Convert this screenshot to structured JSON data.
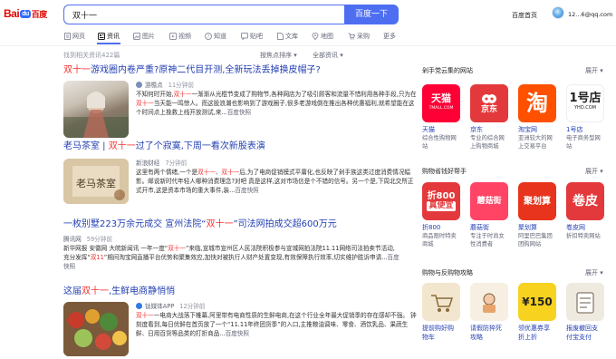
{
  "logo": {
    "part1": "Bai",
    "paw": "du",
    "part2": "百度"
  },
  "search": {
    "query": "双十一",
    "button": "百度一下"
  },
  "header": {
    "home": "百度首页",
    "user": "12...6@qq.com"
  },
  "tabs": [
    {
      "label": "网页",
      "icon": "page-icon"
    },
    {
      "label": "资讯",
      "icon": "news-icon"
    },
    {
      "label": "图片",
      "icon": "image-icon"
    },
    {
      "label": "视频",
      "icon": "video-icon"
    },
    {
      "label": "知道",
      "icon": "question-icon"
    },
    {
      "label": "贴吧",
      "icon": "forum-icon"
    },
    {
      "label": "文库",
      "icon": "doc-icon"
    },
    {
      "label": "地图",
      "icon": "map-icon"
    },
    {
      "label": "采购",
      "icon": "cart-icon"
    },
    {
      "label": "更多",
      "icon": ""
    }
  ],
  "filters": {
    "count": "找到相关资讯422篇",
    "time": "按焦点排序",
    "scope": "全部资讯"
  },
  "results": [
    {
      "title_pre": "双十一",
      "title_rest": "游戏圈内卷严重?原神二代目开测,全新玩法丢掉换皮帽子?",
      "source": "游檐点",
      "time": "11分钟前",
      "snippet_a": "不知何时开始,",
      "snippet_em": "双十一",
      "snippet_b": "一渐渐从光棍节变成了购物节,各种网店为了吸引顾客和流量不惜利用各种手段,只为在",
      "snippet_em2": "双十一",
      "snippet_c": "当天能一鸣惊人。而这股浪潮也影响到了游戏圈子,很多老游戏倒在推出各种优惠福利,就希望能在这个时间点上挽救上线开放测试,来...",
      "more": "百度快照"
    },
    {
      "title_pre": "老马茶室 | ",
      "title_em": "双十一",
      "title_rest": "过了个寂寞,下周一看次新股表演",
      "source": "新浪财经",
      "time": "7分钟前",
      "snippet_a": "这里有两个情绪,一个是",
      "snippet_em": "双十一",
      "snippet_b": "、",
      "snippet_em2": "双十一",
      "snippet_c": "后,为了电商促销模式平庸化,也反映了剁手族这类过度消费情况幅影。邮说新时代年轻人哪种消费理念?对吧 真是这样,这对市场信是个不错的信号。另一个是,下周北交所正式开市,这是资本市场的重大事件,装...",
      "more": "百度快照"
    },
    {
      "title_a": "一枚别墅223万余元成交 宣州法院“",
      "title_em": "双十一",
      "title_rest": "”司法网拍成交超600万元",
      "source": "腾讯网",
      "time": "59分钟前",
      "snippet_a": "新华网报 安徽网 大皖新闻讯 一年一度“",
      "snippet_em": "双十一",
      "snippet_b": "”来临,宣城市宣州区人民法院积极参与宣城网拍法院11.11网络司法拍卖节活动,充分发挥“",
      "snippet_em2": "双11",
      "snippet_c": "”期间淘宝网直播平台优势和聚集效应,加快对被执行人财产处置变现,有效保障执行效率,切实维护胜诉申请...",
      "more": "百度快照"
    },
    {
      "title_pre": "这届",
      "title_em": "双十一",
      "title_rest": ",生鲜电商静悄悄",
      "source": "钛媒体APP",
      "time": "12分钟前",
      "snippet_em": "双十一",
      "snippet_a": "",
      "snippet_b": "一电商大战落下帷幕,阿里带有电商性质的生鲜电商,在这个行业全年最大促销季的存在感却不强。 钟刻度看到,每日优鲜在首页放了一个“11.11年终团货季”的入口,主推粮油调味、零食、酒饮乳品、果蔬生鲜、日用百货等品类的打折商品...",
      "snippet_em2": "",
      "snippet_c": "",
      "more": "百度快照"
    }
  ],
  "sidebar": {
    "sections": [
      {
        "title": "剁手党云集的网站",
        "expand": "展开",
        "apps": [
          {
            "name": "天猫",
            "desc1": "综合性购物网",
            "desc2": "站",
            "icon_text": "天猫\nTMALL.COM",
            "color": "#ff0036",
            "icon": "tmall-icon"
          },
          {
            "name": "京东",
            "desc1": "专业的综合网",
            "desc2": "上购物商城",
            "icon_text": "京东",
            "color": "#e4393c",
            "icon": "jd-icon"
          },
          {
            "name": "淘宝网",
            "desc1": "亚洲较大的网",
            "desc2": "上交易平台",
            "icon_text": "淘",
            "color": "#ff5000",
            "icon": "taobao-icon"
          },
          {
            "name": "1号店",
            "desc1": "电子商务型网",
            "desc2": "站",
            "icon_text": "1号店\nYHD.COM",
            "color": "#ffffff",
            "icon": "yhd-icon"
          }
        ]
      },
      {
        "title": "购物省钱好帮手",
        "expand": "展开",
        "apps": [
          {
            "name": "折800",
            "desc1": "商品限时特卖",
            "desc2": "商城",
            "icon_text": "折800\n真便宜",
            "color": "#e4393c",
            "icon": "zhe800-icon"
          },
          {
            "name": "蘑菇街",
            "desc1": "专注于时尚女",
            "desc2": "性消费者",
            "icon_text": "蘑菇街",
            "color": "#ff4466",
            "icon": "mogu-icon"
          },
          {
            "name": "聚划算",
            "desc1": "阿里巴巴集团",
            "desc2": "团购网站",
            "icon_text": "聚划算",
            "color": "#e8341c",
            "icon": "juhuasuan-icon"
          },
          {
            "name": "卷皮网",
            "desc1": "折扣特卖网站",
            "desc2": "",
            "icon_text": "卷皮",
            "color": "#e4393c",
            "icon": "juanpi-icon"
          }
        ]
      },
      {
        "title": "购物与反购物攻略",
        "expand": "展开",
        "apps": [
          {
            "name": "提前购好购",
            "desc1": "物车",
            "desc2": "",
            "icon_text": "",
            "color": "#f2e6cf",
            "icon": "cart-plan-icon"
          },
          {
            "name": "请假防猝死",
            "desc1": "攻略",
            "desc2": "",
            "icon_text": "",
            "color": "#f6efe2",
            "icon": "rest-plan-icon"
          },
          {
            "name": "领优惠券享",
            "desc1": "折上折",
            "desc2": "",
            "icon_text": "¥150",
            "color": "#f7d21f",
            "icon": "coupon-icon"
          },
          {
            "name": "报废撤回支",
            "desc1": "付宝支付",
            "desc2": "",
            "icon_text": "",
            "color": "#efeadf",
            "icon": "refund-plan-icon"
          }
        ]
      }
    ]
  }
}
